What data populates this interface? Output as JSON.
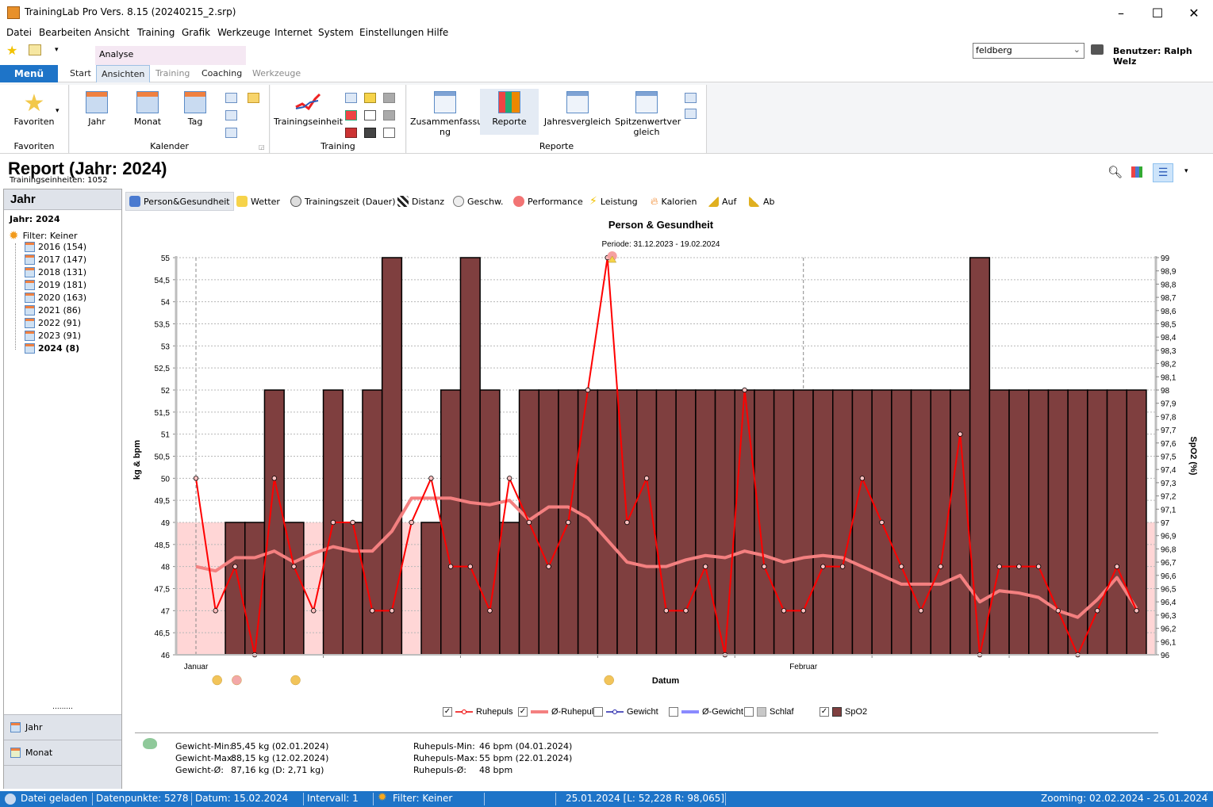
{
  "window": {
    "title": "TrainingLab Pro Vers. 8.15 (20240215_2.srp)",
    "minimize": "–",
    "maximize": "☐",
    "close": "✕"
  },
  "menubar": [
    "Datei",
    "Bearbeiten",
    "Ansicht",
    "Training",
    "Grafik",
    "Werkzeuge",
    "Internet",
    "System",
    "Einstellungen",
    "Hilfe"
  ],
  "context_tab": "Analyse",
  "ribbon_tabs": {
    "menu": "Menü",
    "tabs": [
      "Start",
      "Ansichten",
      "Training",
      "Coaching",
      "Werkzeuge"
    ]
  },
  "profile_select": {
    "value": "feldberg"
  },
  "user_label": "Benutzer: Ralph Welz",
  "ribbon": {
    "favoriten": {
      "button": "Favoriten",
      "group": "Favoriten"
    },
    "kalender": {
      "buttons": [
        "Jahr",
        "Monat",
        "Tag"
      ],
      "group": "Kalender"
    },
    "training": {
      "button": "Trainingseinheit",
      "group": "Training"
    },
    "reporte": {
      "buttons": [
        "Zusammenfassu ng",
        "Reporte",
        "Jahresvergleich",
        "Spitzenwertver gleich"
      ],
      "group": "Reporte"
    }
  },
  "report": {
    "title": "Report (Jahr: 2024)",
    "subtitle": "Trainingseinheiten: 1052"
  },
  "leftpane": {
    "header": "Jahr",
    "year_label": "Jahr: 2024",
    "filter": "Filter: Keiner",
    "years": [
      "2016 (154)",
      "2017 (147)",
      "2018 (131)",
      "2019 (181)",
      "2020 (163)",
      "2021 (86)",
      "2022 (91)",
      "2023 (91)",
      "2024 (8)"
    ],
    "nav": [
      "Jahr",
      "Monat"
    ],
    "splitter": "........."
  },
  "category_tabs": [
    "Person&Gesundheit",
    "Wetter",
    "Trainingszeit (Dauer)",
    "Distanz",
    "Geschw.",
    "Performance",
    "Leistung",
    "Kalorien",
    "Auf",
    "Ab"
  ],
  "legend": [
    "Ruhepuls",
    "Ø-Ruhepuls",
    "Gewicht",
    "Ø-Gewicht",
    "Schlaf",
    "SpO2"
  ],
  "legend_checked": [
    true,
    true,
    false,
    false,
    false,
    true
  ],
  "stats": {
    "left": [
      [
        "Gewicht-Min:",
        "85,45 kg  (02.01.2024)"
      ],
      [
        "Gewicht-Max:",
        "88,15 kg  (12.02.2024)"
      ],
      [
        "Gewicht-Ø:",
        "87,16 kg (D: 2,71 kg)"
      ]
    ],
    "right": [
      [
        "Ruhepuls-Min:",
        "46 bpm  (04.01.2024)"
      ],
      [
        "Ruhepuls-Max:",
        "55 bpm  (22.01.2024)"
      ],
      [
        "Ruhepuls-Ø:",
        "48 bpm"
      ]
    ]
  },
  "statusbar": {
    "loaded": "Datei geladen",
    "datapoints": "Datenpunkte: 5278",
    "date": "Datum: 15.02.2024",
    "interval": "Intervall: 1",
    "filter": "Filter: Keiner",
    "cursor": "25.01.2024 [L: 52,228  R: 98,065]",
    "zooming": "Zooming: 02.02.2024 - 25.01.2024"
  },
  "colors": {
    "accent": "#1e74c8",
    "bar": "#7f3f3f",
    "ruhepuls": "#ff0000",
    "avg_ruhepuls": "#f48080",
    "band": "#ffd6d6"
  },
  "chart_data": {
    "type": "bar+line",
    "title": "Person & Gesundheit",
    "subtitle": "Periode: 31.12.2023 - 19.02.2024",
    "xlabel": "Datum",
    "ylabel": "kg & bpm",
    "y2label": "SpO2 (%)",
    "ylim": [
      46,
      55
    ],
    "y2lim": [
      96,
      99
    ],
    "yticks": [
      "46",
      "46,5",
      "47",
      "47,5",
      "48",
      "48,5",
      "49",
      "49,5",
      "50",
      "50,5",
      "51",
      "51,5",
      "52",
      "52,5",
      "53",
      "53,5",
      "54",
      "54,5",
      "55"
    ],
    "y2ticks": [
      "96",
      "96,1",
      "96,2",
      "96,3",
      "96,4",
      "96,5",
      "96,6",
      "96,7",
      "96,8",
      "96,9",
      "97",
      "97,1",
      "97,2",
      "97,3",
      "97,4",
      "97,5",
      "97,6",
      "97,7",
      "97,8",
      "97,9",
      "98",
      "98,1",
      "98,2",
      "98,3",
      "98,4",
      "98,5",
      "98,6",
      "98,7",
      "98,8",
      "98,9",
      "99"
    ],
    "month_labels": [
      {
        "label": "Januar",
        "day": 1
      },
      {
        "label": "Februar",
        "day": 32
      }
    ],
    "x_day_range": [
      0,
      50
    ],
    "grid": true,
    "legend_position": "bottom",
    "series": [
      {
        "name": "Ruhepuls",
        "type": "line",
        "axis": "left",
        "days": [
          1,
          2,
          3,
          4,
          5,
          6,
          7,
          8,
          9,
          10,
          11,
          12,
          13,
          14,
          15,
          16,
          17,
          18,
          19,
          20,
          21,
          22,
          23,
          24,
          25,
          26,
          27,
          28,
          29,
          30,
          31,
          32,
          33,
          34,
          35,
          36,
          37,
          38,
          39,
          40,
          41,
          42,
          43,
          44,
          45,
          46,
          47,
          48,
          49
        ],
        "values": [
          50,
          47,
          48,
          46,
          50,
          48,
          47,
          49,
          49,
          47,
          47,
          49,
          50,
          48,
          48,
          47,
          50,
          49,
          48,
          49,
          52,
          55,
          49,
          50,
          47,
          47,
          48,
          46,
          52,
          48,
          47,
          47,
          48,
          48,
          50,
          49,
          48,
          47,
          48,
          51,
          46,
          48,
          48,
          48,
          47,
          46,
          47,
          48,
          47
        ]
      },
      {
        "name": "Ø-Ruhepuls",
        "type": "line",
        "axis": "left",
        "days": [
          1,
          2,
          3,
          4,
          5,
          6,
          7,
          8,
          9,
          10,
          11,
          12,
          13,
          14,
          15,
          16,
          17,
          18,
          19,
          20,
          21,
          22,
          23,
          24,
          25,
          26,
          27,
          28,
          29,
          30,
          31,
          32,
          33,
          34,
          35,
          36,
          37,
          38,
          39,
          40,
          41,
          42,
          43,
          44,
          45,
          46,
          47,
          48,
          49
        ],
        "values": [
          48.0,
          47.9,
          48.2,
          48.2,
          48.35,
          48.1,
          48.3,
          48.45,
          48.35,
          48.35,
          48.8,
          49.55,
          49.55,
          49.55,
          49.45,
          49.4,
          49.5,
          49.05,
          49.35,
          49.35,
          49.1,
          48.6,
          48.1,
          48.0,
          48.0,
          48.15,
          48.25,
          48.2,
          48.35,
          48.25,
          48.1,
          48.2,
          48.25,
          48.2,
          48.0,
          47.8,
          47.6,
          47.6,
          47.6,
          47.8,
          47.2,
          47.45,
          47.4,
          47.3,
          47.0,
          46.85,
          47.25,
          47.75,
          47.05
        ]
      },
      {
        "name": "SpO2",
        "type": "bar",
        "axis": "right",
        "days": [
          3,
          4,
          5,
          6,
          8,
          9,
          10,
          11,
          13,
          14,
          15,
          16,
          17,
          18,
          19,
          20,
          21,
          22,
          23,
          24,
          25,
          26,
          27,
          28,
          29,
          30,
          31,
          32,
          33,
          34,
          35,
          36,
          37,
          38,
          39,
          40,
          41,
          42,
          43,
          44,
          45,
          46,
          47,
          48,
          49
        ],
        "values": [
          97,
          97,
          98,
          97,
          98,
          97,
          98,
          99,
          97,
          98,
          99,
          98,
          97,
          98,
          98,
          98,
          98,
          98,
          98,
          98,
          98,
          98,
          98,
          98,
          98,
          98,
          98,
          98,
          98,
          98,
          98,
          98,
          98,
          98,
          98,
          98,
          99,
          98,
          98,
          98,
          98,
          98,
          98,
          98,
          98
        ]
      }
    ],
    "reference_band": {
      "axis": "left",
      "from": 46,
      "to": 49
    },
    "event_icons": [
      {
        "day": 2,
        "icon": "injury-face-icon"
      },
      {
        "day": 3,
        "icon": "sick-face-icon"
      },
      {
        "day": 6,
        "icon": "injury-face-icon"
      },
      {
        "day": 22,
        "icon": "injury-face-icon"
      },
      {
        "day": 22,
        "icon": "heart-warning-icon",
        "position": "top"
      }
    ]
  }
}
